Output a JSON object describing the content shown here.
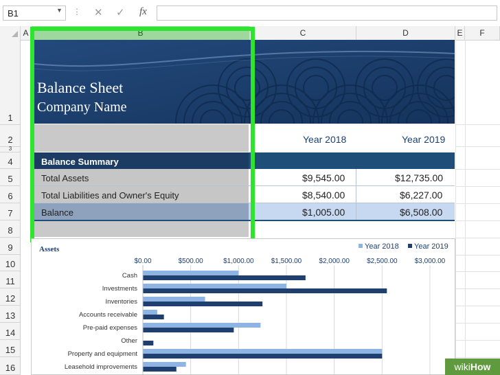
{
  "formula_bar": {
    "name_box": "B1",
    "cancel_icon": "✕",
    "enter_icon": "✓",
    "fx_label": "fx",
    "formula": ""
  },
  "columns": [
    "A",
    "B",
    "C",
    "D",
    "E",
    "F"
  ],
  "rows": [
    "1",
    "2",
    "3",
    "4",
    "5",
    "6",
    "7",
    "8",
    "9",
    "10",
    "11",
    "12",
    "13",
    "14",
    "15",
    "16"
  ],
  "sheet": {
    "title": "Balance Sheet",
    "company": "Company Name",
    "year_2018": "Year 2018",
    "year_2019": "Year 2019",
    "summary_header": "Balance Summary",
    "lines": [
      {
        "label": "Total Assets",
        "y2018": "$9,545.00",
        "y2019": "$12,735.00"
      },
      {
        "label": "Total Liabilities and Owner's Equity",
        "y2018": "$8,540.00",
        "y2019": "$6,227.00"
      },
      {
        "label": "Balance",
        "y2018": "$1,005.00",
        "y2019": "$6,508.00"
      }
    ]
  },
  "colors": {
    "banner": "#1b3a66",
    "header_band": "#1f4e79",
    "balance_row": "#c7d9f1",
    "selection": "#2ee52e",
    "series_2018": "#8eb4e3",
    "series_2019": "#1f3f6e"
  },
  "chart_data": {
    "type": "bar",
    "orientation": "horizontal",
    "title": "Assets",
    "categories": [
      "Cash",
      "Investments",
      "Inventories",
      "Accounts receivable",
      "Pre-paid expenses",
      "Other",
      "Property and equipment",
      "Leasehold improvements"
    ],
    "series": [
      {
        "name": "Year 2018",
        "values": [
          1000,
          1500,
          650,
          150,
          1230,
          0,
          2500,
          450
        ]
      },
      {
        "name": "Year 2019",
        "values": [
          1700,
          2550,
          1250,
          220,
          950,
          110,
          2500,
          350
        ]
      }
    ],
    "xlim": [
      0,
      3000
    ],
    "xticks": [
      "$0.00",
      "$500.00",
      "$1,000.00",
      "$1,500.00",
      "$2,000.00",
      "$2,500.00",
      "$3,000.00"
    ],
    "legend": "top-right",
    "grid": true
  },
  "watermark": {
    "wiki": "wiki",
    "how": "How"
  }
}
